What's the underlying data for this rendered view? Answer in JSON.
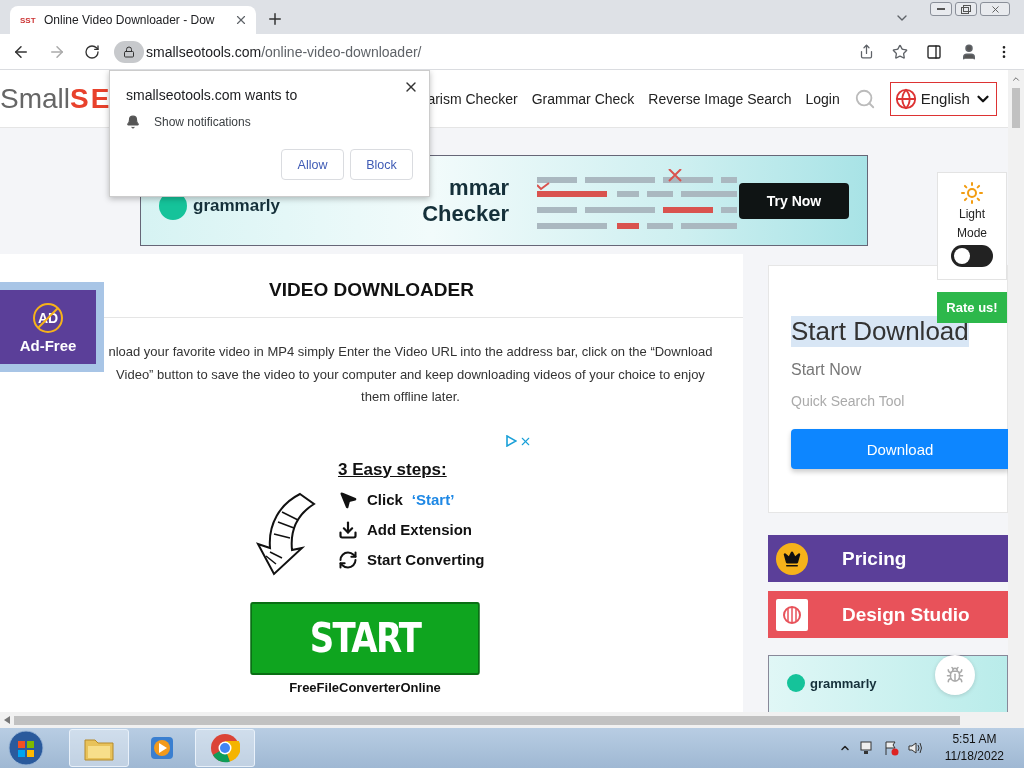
{
  "browser": {
    "tab": {
      "favicon": "SST",
      "title": "Online Video Downloader - Dow",
      "selected": true
    },
    "url_host": "smallseotools.com",
    "url_path": "/online-video-downloader/"
  },
  "permission_popup": {
    "title": "smallseotools.com wants to",
    "permission": "Show notifications",
    "buttons": [
      "Allow",
      "Block"
    ]
  },
  "header": {
    "logo_parts": [
      "Small",
      "SE"
    ],
    "nav": [
      "arism Checker",
      "Grammar Check",
      "Reverse Image Search",
      "Login"
    ],
    "language": "English"
  },
  "banner_ad": {
    "logo": "grammarly",
    "headline": [
      "mmar",
      "Checker"
    ],
    "button": "Try Now"
  },
  "theme_widget": {
    "label_lines": [
      "Light",
      "Mode"
    ],
    "on": false
  },
  "rate_button": "Rate us!",
  "ad_free_badge": {
    "icon_text": "AD",
    "label": "Ad-Free"
  },
  "main": {
    "title": "VIDEO DOWNLOADER",
    "intro": "nload your favorite video in MP4 simply Enter the Video URL into the address bar, click on the “Download Video” button to save the video to your computer and keep downloading videos of your choice to enjoy them offline later.",
    "ad": {
      "heading": "3 Easy steps:",
      "steps": [
        {
          "kind": "click",
          "text": "Click",
          "highlight": "‘Start’"
        },
        {
          "kind": "download",
          "text": "Add Extension"
        },
        {
          "kind": "convert",
          "text": "Start Converting"
        }
      ],
      "start_button": "START",
      "brand": "FreeFileConverterOnline"
    }
  },
  "sidebar": {
    "card": {
      "title": "Start Download",
      "subtitle": "Start Now",
      "caption": "Quick Search Tool",
      "button": "Download"
    },
    "links": [
      {
        "kind": "pricing",
        "label": "Pricing",
        "color": "#5b3f99"
      },
      {
        "kind": "design",
        "label": "Design Studio",
        "color": "#e8525a"
      }
    ],
    "ad_logo": "grammarly"
  },
  "taskbar": {
    "apps": [
      {
        "kind": "explorer",
        "open": true
      },
      {
        "kind": "media",
        "open": false
      },
      {
        "kind": "chrome",
        "open": true
      }
    ],
    "time": "5:51 AM",
    "date": "11/18/2022"
  }
}
